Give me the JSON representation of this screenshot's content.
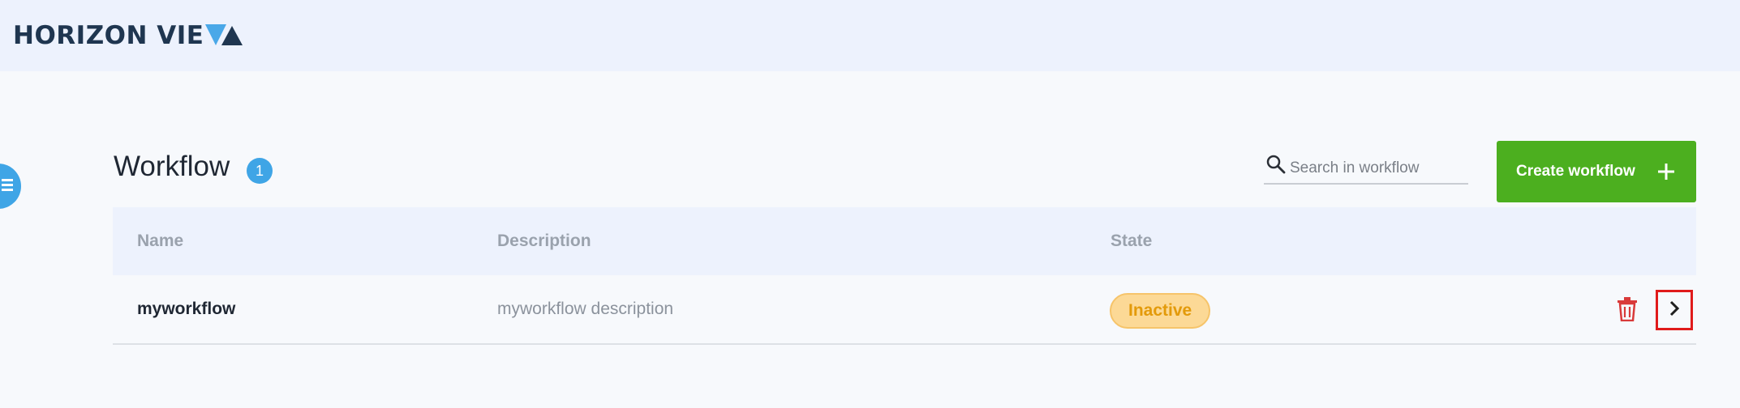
{
  "header": {
    "logo_text": "HORIZON VIE",
    "logo_colors": {
      "dark": "#1f3650",
      "light": "#4aa8e8"
    }
  },
  "sidebar": {
    "toggle_icon": "menu-icon"
  },
  "page": {
    "title": "Workflow",
    "count": "1"
  },
  "search": {
    "placeholder": "Search in workflow",
    "value": ""
  },
  "actions": {
    "create_label": "Create workflow",
    "create_color": "#4caf1f"
  },
  "table": {
    "columns": [
      "Name",
      "Description",
      "State"
    ],
    "rows": [
      {
        "name": "myworkflow",
        "description": "myworkflow description",
        "state": "Inactive"
      }
    ]
  },
  "colors": {
    "accent": "#3fa5e6",
    "header_bg": "#edf2fd",
    "inactive_badge_bg": "#fcd996",
    "inactive_badge_text": "#e39a0a",
    "delete_icon": "#d93a3a",
    "highlight_border": "#e01b1b"
  }
}
